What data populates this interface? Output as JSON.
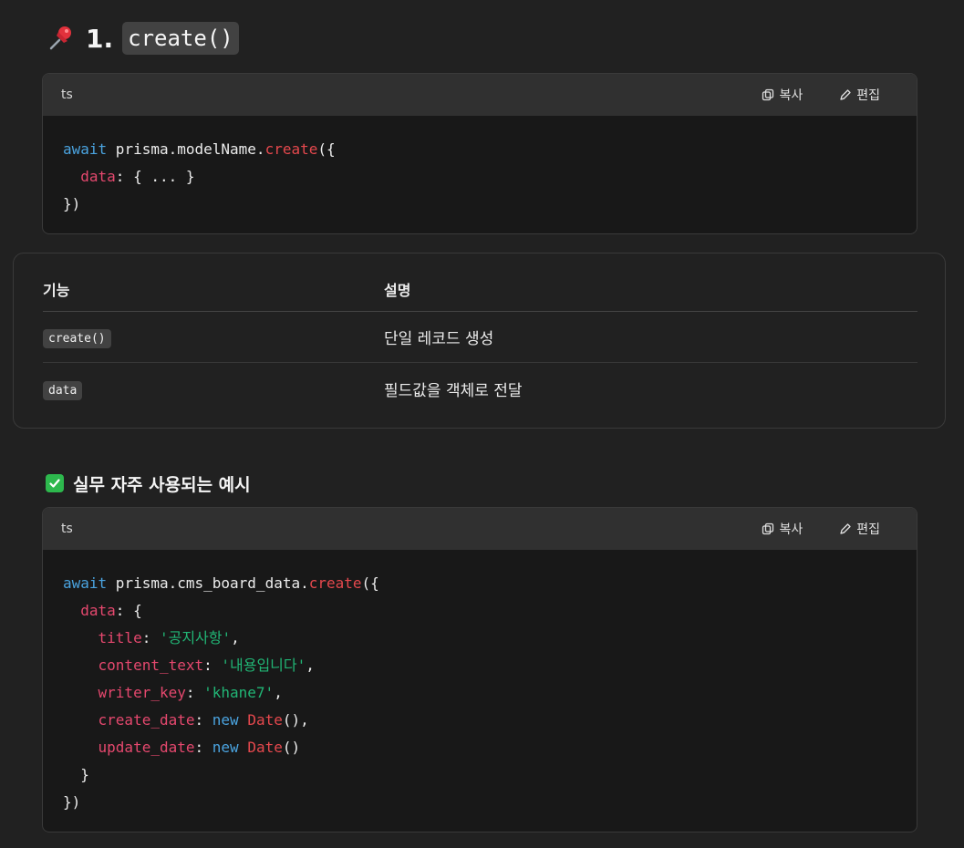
{
  "heading": {
    "number": "1.",
    "code": "create()"
  },
  "code_block_1": {
    "language": "ts",
    "copy_label": "복사",
    "edit_label": "편집",
    "lines": [
      [
        {
          "t": "await",
          "c": "kw"
        },
        {
          "t": " prisma.modelName.",
          "c": ""
        },
        {
          "t": "create",
          "c": "fn"
        },
        {
          "t": "({",
          "c": ""
        }
      ],
      [
        {
          "t": "  ",
          "c": ""
        },
        {
          "t": "data",
          "c": "prop"
        },
        {
          "t": ": { ... }",
          "c": ""
        }
      ],
      [
        {
          "t": "})",
          "c": ""
        }
      ]
    ]
  },
  "table": {
    "headers": [
      "기능",
      "설명"
    ],
    "rows": [
      {
        "feature": "create()",
        "description": "단일 레코드 생성"
      },
      {
        "feature": "data",
        "description": "필드값을 객체로 전달"
      }
    ]
  },
  "sub_heading": {
    "text": "실무 자주 사용되는 예시"
  },
  "code_block_2": {
    "language": "ts",
    "copy_label": "복사",
    "edit_label": "편집",
    "lines": [
      [
        {
          "t": "await",
          "c": "kw"
        },
        {
          "t": " prisma.cms_board_data.",
          "c": ""
        },
        {
          "t": "create",
          "c": "fn"
        },
        {
          "t": "({",
          "c": ""
        }
      ],
      [
        {
          "t": "  ",
          "c": ""
        },
        {
          "t": "data",
          "c": "prop"
        },
        {
          "t": ": {",
          "c": ""
        }
      ],
      [
        {
          "t": "    ",
          "c": ""
        },
        {
          "t": "title",
          "c": "prop"
        },
        {
          "t": ": ",
          "c": ""
        },
        {
          "t": "'공지사항'",
          "c": "str"
        },
        {
          "t": ",",
          "c": ""
        }
      ],
      [
        {
          "t": "    ",
          "c": ""
        },
        {
          "t": "content_text",
          "c": "prop"
        },
        {
          "t": ": ",
          "c": ""
        },
        {
          "t": "'내용입니다'",
          "c": "str"
        },
        {
          "t": ",",
          "c": ""
        }
      ],
      [
        {
          "t": "    ",
          "c": ""
        },
        {
          "t": "writer_key",
          "c": "prop"
        },
        {
          "t": ": ",
          "c": ""
        },
        {
          "t": "'khane7'",
          "c": "str"
        },
        {
          "t": ",",
          "c": ""
        }
      ],
      [
        {
          "t": "    ",
          "c": ""
        },
        {
          "t": "create_date",
          "c": "prop"
        },
        {
          "t": ": ",
          "c": ""
        },
        {
          "t": "new",
          "c": "kw"
        },
        {
          "t": " ",
          "c": ""
        },
        {
          "t": "Date",
          "c": "fn"
        },
        {
          "t": "(),",
          "c": ""
        }
      ],
      [
        {
          "t": "    ",
          "c": ""
        },
        {
          "t": "update_date",
          "c": "prop"
        },
        {
          "t": ": ",
          "c": ""
        },
        {
          "t": "new",
          "c": "kw"
        },
        {
          "t": " ",
          "c": ""
        },
        {
          "t": "Date",
          "c": "fn"
        },
        {
          "t": "()",
          "c": ""
        }
      ],
      [
        {
          "t": "  }",
          "c": ""
        }
      ],
      [
        {
          "t": "})",
          "c": ""
        }
      ]
    ]
  },
  "colors": {
    "background": "#212121",
    "keyword": "#4aa3df",
    "function": "#e5484d",
    "property": "#e5486e",
    "string": "#21b575",
    "check": "#2db84d"
  },
  "icons": {
    "heading": "pushpin-icon",
    "sub_heading": "check-mark-icon",
    "copy": "copy-icon",
    "edit": "pencil-icon"
  }
}
